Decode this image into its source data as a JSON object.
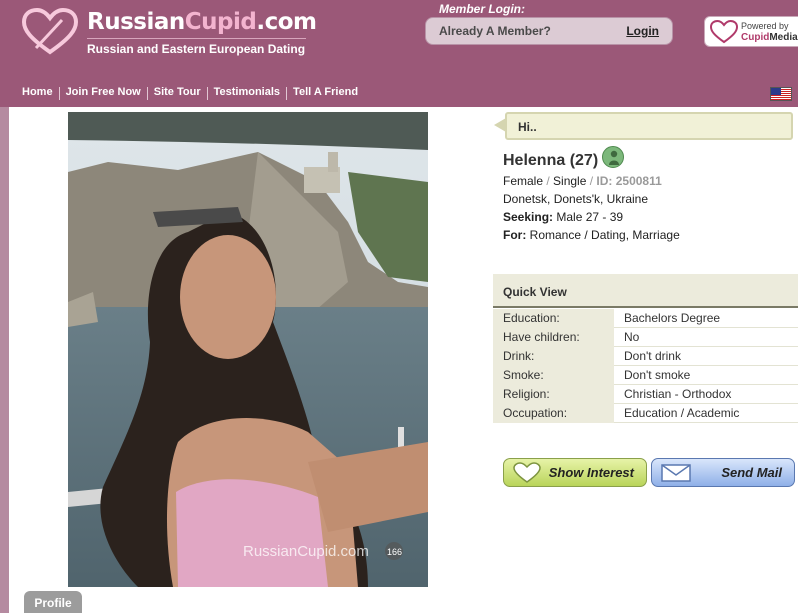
{
  "brand": {
    "title_main": "Russian",
    "title_accent": "Cupid",
    "title_tail": ".com",
    "tagline": "Russian and Eastern European Dating",
    "watermark": "RussianCupid.com"
  },
  "login": {
    "heading": "Member Login:",
    "prompt": "Already A Member?",
    "link": "Login"
  },
  "powered_by": {
    "line1": "Powered by",
    "line2a": "Cupid",
    "line2b": "Media"
  },
  "nav": {
    "items": [
      "Home",
      "Join Free Now",
      "Site Tour",
      "Testimonials",
      "Tell A Friend"
    ]
  },
  "greeting": "Hi..",
  "profile": {
    "name": "Helenna (27)",
    "gender": "Female",
    "status": "Single",
    "id_text": "ID: 2500811",
    "location": "Donetsk, Donets'k, Ukraine",
    "seeking_label": "Seeking:",
    "seeking": "Male 27 - 39",
    "for_label": "For:",
    "for": "Romance / Dating, Marriage"
  },
  "quick_view": {
    "title": "Quick View",
    "rows": [
      {
        "key": "Education:",
        "value": "Bachelors Degree"
      },
      {
        "key": "Have children:",
        "value": "No"
      },
      {
        "key": "Drink:",
        "value": "Don't drink"
      },
      {
        "key": "Smoke:",
        "value": "Don't smoke"
      },
      {
        "key": "Religion:",
        "value": "Christian - Orthodox"
      },
      {
        "key": "Occupation:",
        "value": "Education / Academic"
      }
    ]
  },
  "actions": {
    "interest": "Show Interest",
    "mail": "Send Mail"
  },
  "tabs": {
    "profile": "Profile"
  },
  "photo": {
    "badge": "166"
  },
  "colors": {
    "header": "#9b5878",
    "accent_pink": "#f3b4cf",
    "quickview_bg": "#ecebdc",
    "interest_green": "#b9d45a",
    "mail_blue": "#8fb0e8"
  }
}
